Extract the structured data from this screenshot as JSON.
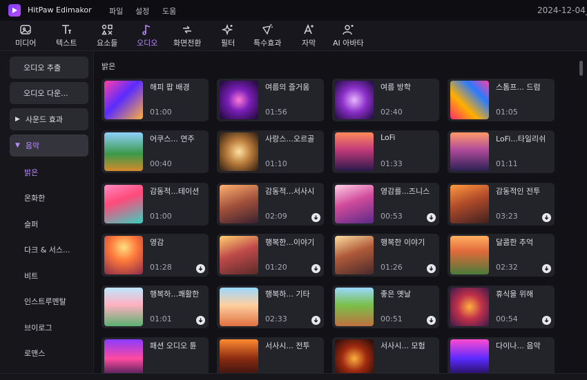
{
  "app": {
    "title": "HitPaw Edimakor",
    "menu": [
      "파일",
      "설정",
      "도움"
    ],
    "date": "2024-12-04_0"
  },
  "toolbar": {
    "items": [
      {
        "label": "미디어",
        "icon": "media-icon"
      },
      {
        "label": "텍스트",
        "icon": "text-icon"
      },
      {
        "label": "요소들",
        "icon": "elements-icon"
      },
      {
        "label": "오디오",
        "icon": "music-note-icon",
        "active": true
      },
      {
        "label": "화면전환",
        "icon": "transition-icon"
      },
      {
        "label": "필터",
        "icon": "filter-sparkle-icon"
      },
      {
        "label": "특수효과",
        "icon": "effects-icon"
      },
      {
        "label": "자막",
        "icon": "subtitle-icon"
      },
      {
        "label": "AI 아바타",
        "icon": "ai-avatar-icon"
      }
    ]
  },
  "sidebar": {
    "buttons": [
      "오디오 추출",
      "오디오 다운..."
    ],
    "categories": [
      {
        "label": "사운드 효과",
        "expanded": false
      },
      {
        "label": "음악",
        "expanded": true
      }
    ],
    "subitems": [
      "밝은",
      "온화한",
      "슬퍼",
      "다크 & 서스...",
      "비트",
      "인스트루멘탈",
      "브이로그",
      "로맨스"
    ],
    "active_subitem": "밝은"
  },
  "content": {
    "section_title": "밝은",
    "tracks": [
      {
        "title": "해피 팝 배경",
        "duration": "01:00",
        "download": false
      },
      {
        "title": "여름의 즐거움",
        "duration": "01:56",
        "download": false
      },
      {
        "title": "여름 방학",
        "duration": "02:40",
        "download": false
      },
      {
        "title": "스톰프... 드럼",
        "duration": "01:05",
        "download": false
      },
      {
        "title": "어쿠스... 연주",
        "duration": "00:40",
        "download": false
      },
      {
        "title": "사랑스...오르골",
        "duration": "01:10",
        "download": false
      },
      {
        "title": "LoFi",
        "duration": "01:33",
        "download": false
      },
      {
        "title": "LoFi...타일리쉬",
        "duration": "01:11",
        "download": false
      },
      {
        "title": "감동적...테이션",
        "duration": "01:00",
        "download": false
      },
      {
        "title": "감동적...서사시",
        "duration": "02:09",
        "download": true
      },
      {
        "title": "영감를...즈니스",
        "duration": "00:53",
        "download": true
      },
      {
        "title": "감동적인 전투",
        "duration": "03:23",
        "download": true
      },
      {
        "title": "영감",
        "duration": "01:28",
        "download": true
      },
      {
        "title": "행복한...이야기",
        "duration": "01:20",
        "download": true
      },
      {
        "title": "행복한 이야기",
        "duration": "01:26",
        "download": true
      },
      {
        "title": "달콤한 추억",
        "duration": "02:32",
        "download": true
      },
      {
        "title": "행복하...쾌활한",
        "duration": "01:01",
        "download": true
      },
      {
        "title": "행복하... 기타",
        "duration": "02:33",
        "download": true
      },
      {
        "title": "좋은 옛날",
        "duration": "00:51",
        "download": true
      },
      {
        "title": "휴식을 위해",
        "duration": "00:54",
        "download": true
      },
      {
        "title": "패션 오디오 튠",
        "duration": "",
        "download": false
      },
      {
        "title": "서사시... 전투",
        "duration": "",
        "download": false
      },
      {
        "title": "서사시... 모험",
        "duration": "",
        "download": false
      },
      {
        "title": "다이나... 음악",
        "duration": "",
        "download": false
      }
    ]
  },
  "colors": {
    "accent": "#b88cff",
    "card_bg": "#23232a",
    "app_bg": "#111116"
  }
}
